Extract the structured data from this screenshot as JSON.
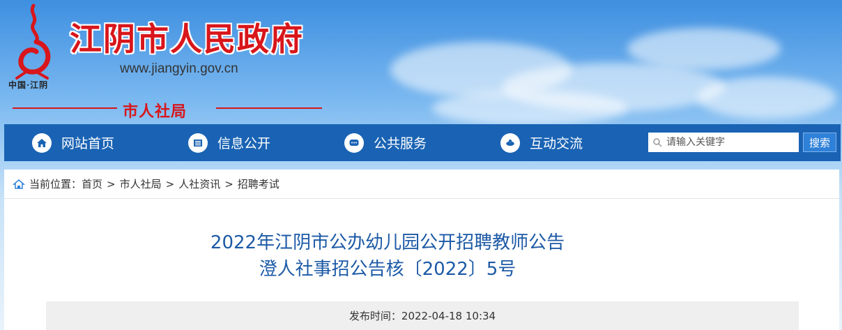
{
  "header": {
    "logo_caption": "中国·江阴",
    "site_title": "江阴市人民政府",
    "site_url": "www.jiangyin.gov.cn",
    "department": "市人社局"
  },
  "nav": {
    "items": [
      {
        "label": "网站首页",
        "icon": "home-icon"
      },
      {
        "label": "信息公开",
        "icon": "document-icon"
      },
      {
        "label": "公共服务",
        "icon": "chat-icon"
      },
      {
        "label": "互动交流",
        "icon": "handshake-icon"
      }
    ],
    "search_placeholder": "请输入关键字",
    "search_button": "搜索"
  },
  "breadcrumb": {
    "prefix": "当前位置：",
    "items": [
      "首页",
      "市人社局",
      "人社资讯",
      "招聘考试"
    ],
    "separator": ">"
  },
  "article": {
    "title": "2022年江阴市公办幼儿园公开招聘教师公告",
    "subtitle": "澄人社事招公告核〔2022〕5号",
    "publish_label": "发布时间：",
    "publish_time": "2022-04-18 10:34"
  },
  "colors": {
    "brand_red": "#d8161b",
    "nav_blue": "#1a63b4",
    "title_blue": "#1d5aa6"
  }
}
